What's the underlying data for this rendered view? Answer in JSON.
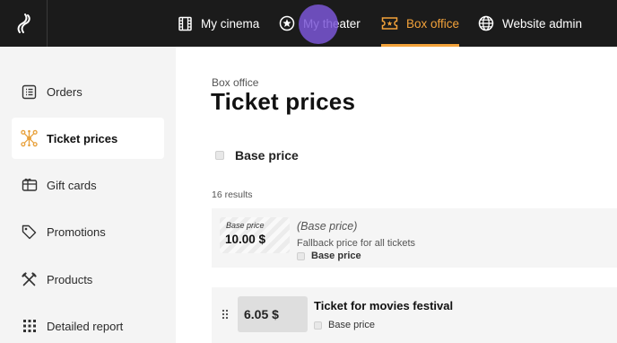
{
  "topnav": {
    "items": [
      {
        "label": "My cinema",
        "icon": "cinema-film-icon"
      },
      {
        "label": "My theater",
        "icon": "star-circle-icon"
      },
      {
        "label": "Box office",
        "icon": "ticket-icon",
        "active": true
      },
      {
        "label": "Website admin",
        "icon": "globe-icon"
      }
    ],
    "accent_color": "#f3a23a"
  },
  "sidebar": {
    "items": [
      {
        "label": "Orders",
        "icon": "orders-list-icon"
      },
      {
        "label": "Ticket prices",
        "icon": "ticket-prices-network-icon",
        "active": true
      },
      {
        "label": "Gift cards",
        "icon": "gift-card-icon"
      },
      {
        "label": "Promotions",
        "icon": "tag-icon"
      },
      {
        "label": "Products",
        "icon": "fork-knife-icon"
      },
      {
        "label": "Detailed report",
        "icon": "report-grid-icon"
      }
    ]
  },
  "main": {
    "breadcrumb": "Box office",
    "title": "Ticket prices",
    "filter_label": "Base price",
    "results": "16 results",
    "rows": [
      {
        "chip_label": "Base price",
        "price": "10.00 $",
        "name": "(Base price)",
        "description": "Fallback price for all tickets",
        "tag": "Base price"
      },
      {
        "price": "6.05 $",
        "name": "Ticket for movies festival",
        "tag": "Base price"
      }
    ]
  }
}
